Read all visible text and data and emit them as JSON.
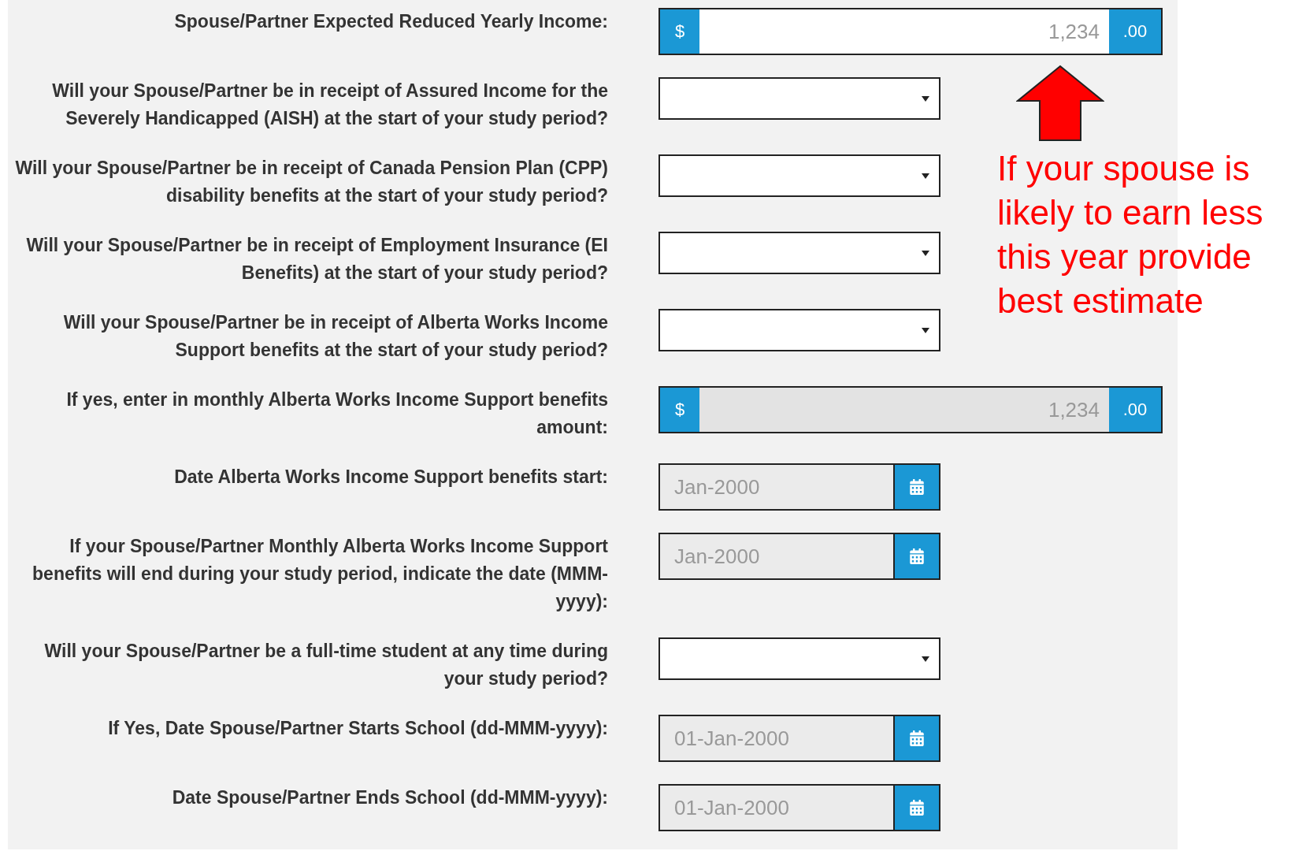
{
  "fields": [
    {
      "kind": "currency",
      "label": "Spouse/Partner Expected Reduced Yearly Income:",
      "prefix": "$",
      "placeholder": "1,234",
      "suffix": ".00",
      "disabled": false
    },
    {
      "kind": "select",
      "label": "Will your Spouse/Partner be in receipt of Assured Income for the Severely Handicapped (AISH) at the start of your study period?",
      "disabled": false
    },
    {
      "kind": "select",
      "label": "Will your Spouse/Partner be in receipt of Canada Pension Plan (CPP) disability benefits at the start of your study period?",
      "disabled": false
    },
    {
      "kind": "select",
      "label": "Will your Spouse/Partner be in receipt of Employment Insurance (EI Benefits) at the start of your study period?",
      "disabled": false
    },
    {
      "kind": "select",
      "label": "Will your Spouse/Partner be in receipt of Alberta Works Income Support benefits at the start of your study period?",
      "disabled": false
    },
    {
      "kind": "currency",
      "label": "If yes, enter in monthly Alberta Works Income Support benefits amount:",
      "prefix": "$",
      "placeholder": "1,234",
      "suffix": ".00",
      "disabled": true
    },
    {
      "kind": "date",
      "label": "Date Alberta Works Income Support benefits start:",
      "placeholder": "Jan-2000",
      "disabled": true
    },
    {
      "kind": "date",
      "label": "If your Spouse/Partner Monthly Alberta Works Income Support benefits will end during your study period, indicate the date (MMM-yyyy):",
      "placeholder": "Jan-2000",
      "disabled": true
    },
    {
      "kind": "select",
      "label": "Will your Spouse/Partner be a full-time student at any time during your study period?",
      "disabled": false
    },
    {
      "kind": "date",
      "label": "If Yes, Date Spouse/Partner Starts School (dd-MMM-yyyy):",
      "placeholder": "01-Jan-2000",
      "disabled": true
    },
    {
      "kind": "date",
      "label": "Date Spouse/Partner Ends School (dd-MMM-yyyy):",
      "placeholder": "01-Jan-2000",
      "disabled": true
    }
  ],
  "annotation": {
    "text": "If your spouse is likely to earn less this year provide best estimate"
  }
}
